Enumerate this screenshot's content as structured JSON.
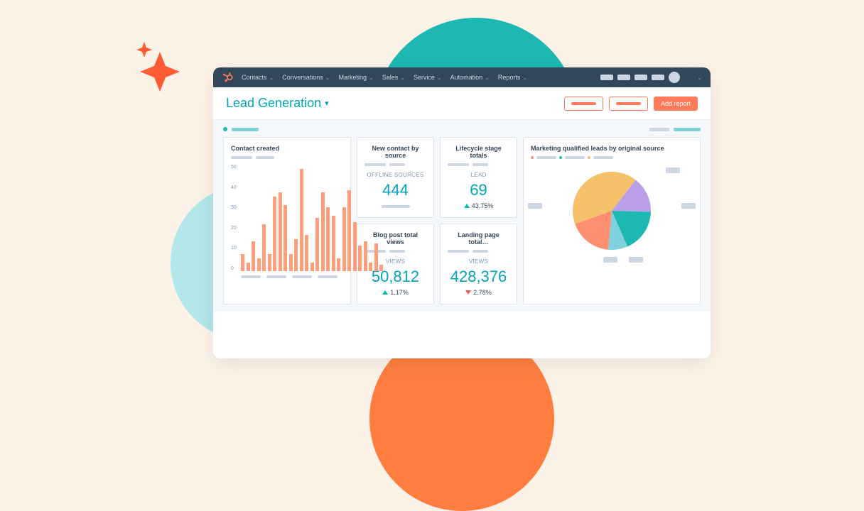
{
  "nav": {
    "items": [
      "Contacts",
      "Conversations",
      "Marketing",
      "Sales",
      "Service",
      "Automation",
      "Reports"
    ]
  },
  "header": {
    "page_title": "Lead Generation",
    "add_report": "Add report"
  },
  "cards": {
    "contact_created": {
      "title": "Contact created"
    },
    "new_contact": {
      "title": "New contact by source",
      "label": "OFFLINE SOURCES",
      "value": "444"
    },
    "lifecycle": {
      "title": "Lifecycle stage totals",
      "label": "LEAD",
      "value": "69",
      "change": "43.75%",
      "direction": "up"
    },
    "blog_views": {
      "title": "Blog post total views",
      "label": "VIEWS",
      "value": "50,812",
      "change": "1.17%",
      "direction": "up"
    },
    "landing_views": {
      "title": "Landing page total…",
      "label": "VIEWS",
      "value": "428,376",
      "change": "2.78%",
      "direction": "down"
    },
    "mql": {
      "title": "Marketing qualified leads by original source"
    }
  },
  "chart_data": {
    "bar": {
      "type": "bar",
      "y_ticks": [
        50,
        40,
        30,
        20,
        10,
        0
      ],
      "values": [
        8,
        4,
        14,
        6,
        22,
        8,
        35,
        37,
        31,
        8,
        15,
        48,
        17,
        4,
        25,
        37,
        30,
        26,
        6,
        30,
        38,
        23,
        12,
        14,
        4,
        13,
        3
      ]
    },
    "pie": {
      "type": "pie",
      "slices": [
        {
          "value": 41,
          "color": "#f5c26b"
        },
        {
          "value": 15,
          "color": "#b9a0e8"
        },
        {
          "value": 18,
          "color": "#1eb8b3"
        },
        {
          "value": 8,
          "color": "#7fd1de"
        },
        {
          "value": 18,
          "color": "#ff8f73"
        }
      ]
    }
  },
  "colors": {
    "accent": "#ff7a59",
    "teal": "#00a4bd"
  }
}
